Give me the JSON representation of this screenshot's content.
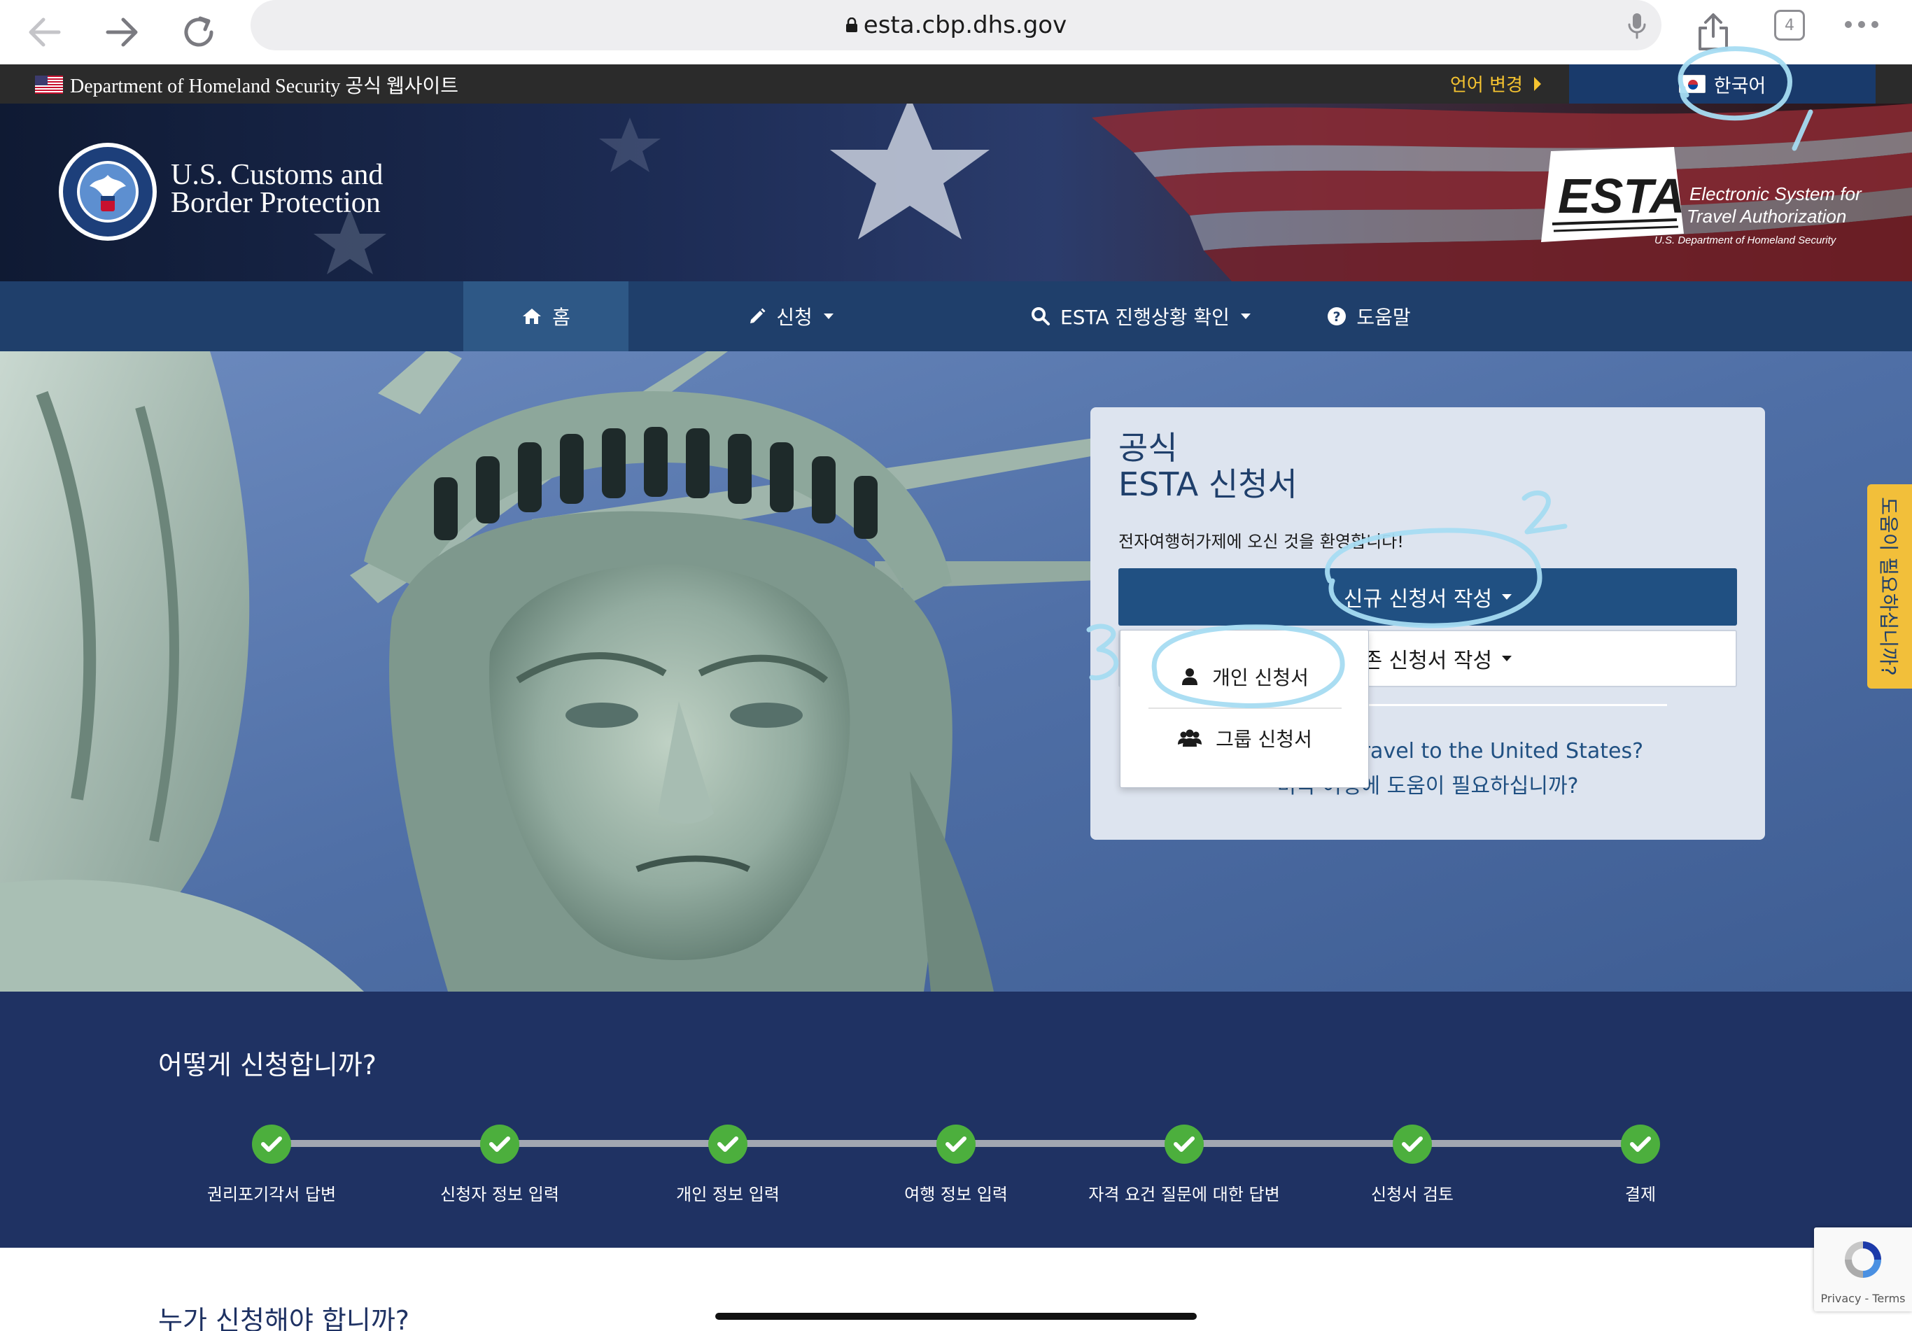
{
  "browser": {
    "url": "esta.cbp.dhs.gov",
    "tab_count": "4"
  },
  "gov_banner": {
    "text": "Department of Homeland Security 공식 웹사이트",
    "change_language": "언어 변경",
    "current_language": "한국어"
  },
  "header": {
    "agency_line1": "U.S. Customs and",
    "agency_line2": "Border Protection",
    "esta_wordmark": "ESTA",
    "esta_tagline1": "Electronic System for",
    "esta_tagline2": "Travel Authorization",
    "esta_tagline3": "U.S. Department of Homeland Security",
    "seal_text": "U.S. DEPARTMENT OF HOMELAND SECURITY"
  },
  "nav": {
    "items": [
      {
        "label": "홈",
        "icon": "home-icon",
        "active": true
      },
      {
        "label": "신청",
        "icon": "pencil-icon",
        "dropdown": true
      },
      {
        "label": "ESTA 진행상황 확인",
        "icon": "search-icon",
        "dropdown": true
      },
      {
        "label": "도움말",
        "icon": "question-circle-icon"
      }
    ]
  },
  "panel": {
    "heading_line1": "공식",
    "heading_line2": "ESTA 신청서",
    "welcome": "전자여행허가제에 오신 것을 환영합니다!",
    "new_application": "신규 신청서 작성",
    "existing_application": "기존 신청서 작성",
    "link_en": "Need help to travel to the United States?",
    "link_ko": "미국 여행에 도움이 필요하십니까?"
  },
  "dropdown": {
    "individual": "개인 신청서",
    "group": "그룹 신청서"
  },
  "help_tab": "도움이 필요하십니까?",
  "how_to_apply": {
    "title": "어떻게 신청합니까?",
    "steps": [
      "권리포기각서 답변",
      "신청자 정보 입력",
      "개인 정보 입력",
      "여행 정보 입력",
      "자격 요건 질문에 대한 답변",
      "신청서 검토",
      "결제"
    ]
  },
  "who_should_apply": {
    "title": "누가 신청해야 합니까?"
  },
  "recaptcha": {
    "text": "Privacy - Terms"
  },
  "annotations": [
    "1",
    "2",
    "3"
  ],
  "colors": {
    "nav": "#1f3f6b",
    "primary_button": "#205082",
    "steps_bg": "#1f3263",
    "check": "#4caf3d",
    "help_tab": "#f2bf3a",
    "annotation": "#a6dcf2"
  }
}
